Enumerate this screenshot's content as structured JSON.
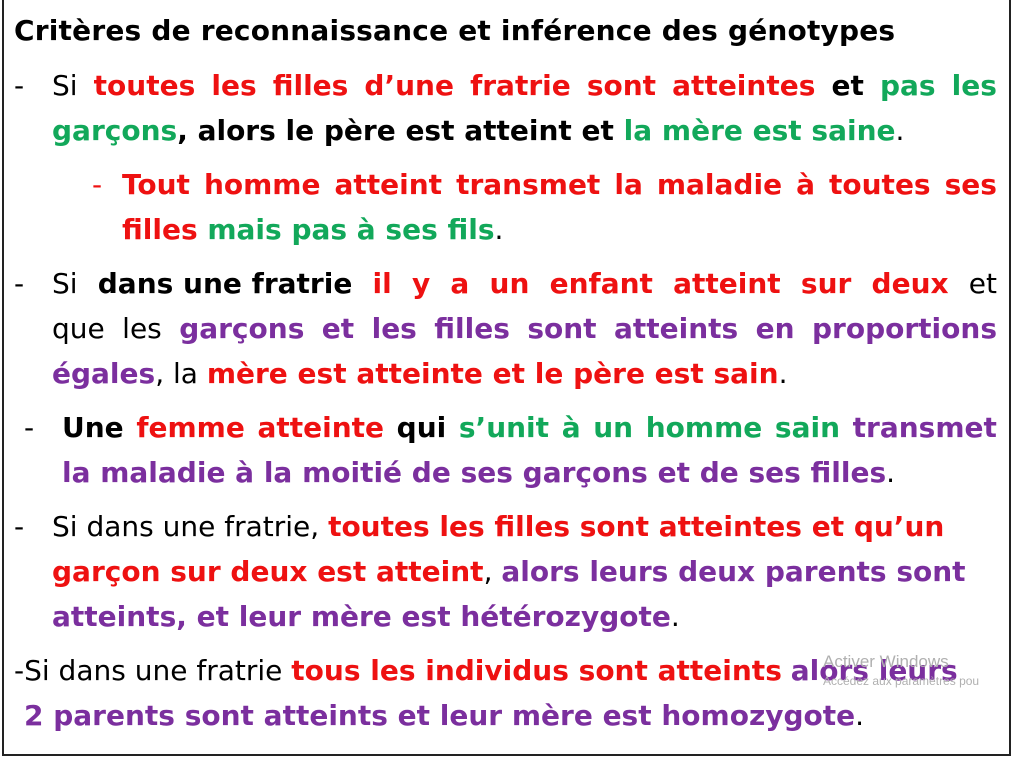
{
  "title": "Critères de reconnaissance et inférence des génotypes",
  "dash": "-",
  "s1": {
    "l1": [
      "Si",
      "toutes",
      "les",
      "filles",
      "d’une",
      "fratrie",
      "sont",
      "atteintes",
      "et",
      "pas",
      "les"
    ],
    "l2a": "garçons",
    "l2b": ", alors le père est atteint et ",
    "l2c": "la mère est saine",
    "l2d": "."
  },
  "s1sub": {
    "l1": [
      "Tout",
      "homme",
      "atteint",
      "transmet",
      "la",
      "maladie",
      "à",
      "toutes",
      "ses"
    ],
    "l2a": "filles",
    "l2b": " mais pas à ses fils",
    "l2c": "."
  },
  "s2": {
    "l1": [
      "Si",
      "dans une fratrie",
      "il",
      "y",
      "a",
      "un",
      "enfant",
      "atteint",
      "sur",
      "deux",
      "et"
    ],
    "l2": [
      "que",
      "les",
      "garçons",
      "et",
      "les",
      "filles",
      "sont",
      "atteints",
      "en",
      "proportions"
    ],
    "l3a": "égales",
    "l3b": ", la ",
    "l3c": "mère est atteinte et le père est sain",
    "l3d": "."
  },
  "s3": {
    "l1": [
      "Une",
      "femme",
      "atteinte",
      "qui",
      "s’unit",
      "à",
      "un",
      "homme",
      "sain",
      "transmet"
    ],
    "l2a": "la maladie à la moitié de ses garçons et de ses filles",
    "l2b": "."
  },
  "s4": {
    "l1a": "Si dans une fratrie, ",
    "l1b": "toutes les filles sont atteintes et qu’un",
    "l2a": "garçon sur deux est atteint",
    "l2b": ", ",
    "l2c": "alors leurs deux parents sont",
    "l3a": "atteints, et leur mère est hétérozygote",
    "l3b": "."
  },
  "s5": {
    "l1a": "-Si dans une fratrie ",
    "l1b": "tous les individus sont atteints",
    "l1c": "alors leurs",
    "l2a": "2 parents sont atteints et leur mère est homozygote",
    "l2b": "."
  },
  "watermark": {
    "line1": "Activer Windows",
    "line2": "Accédez aux paramètres pou"
  },
  "colors": {
    "red": "#ee1111",
    "green": "#12a85a",
    "purple": "#7b2f9e"
  }
}
